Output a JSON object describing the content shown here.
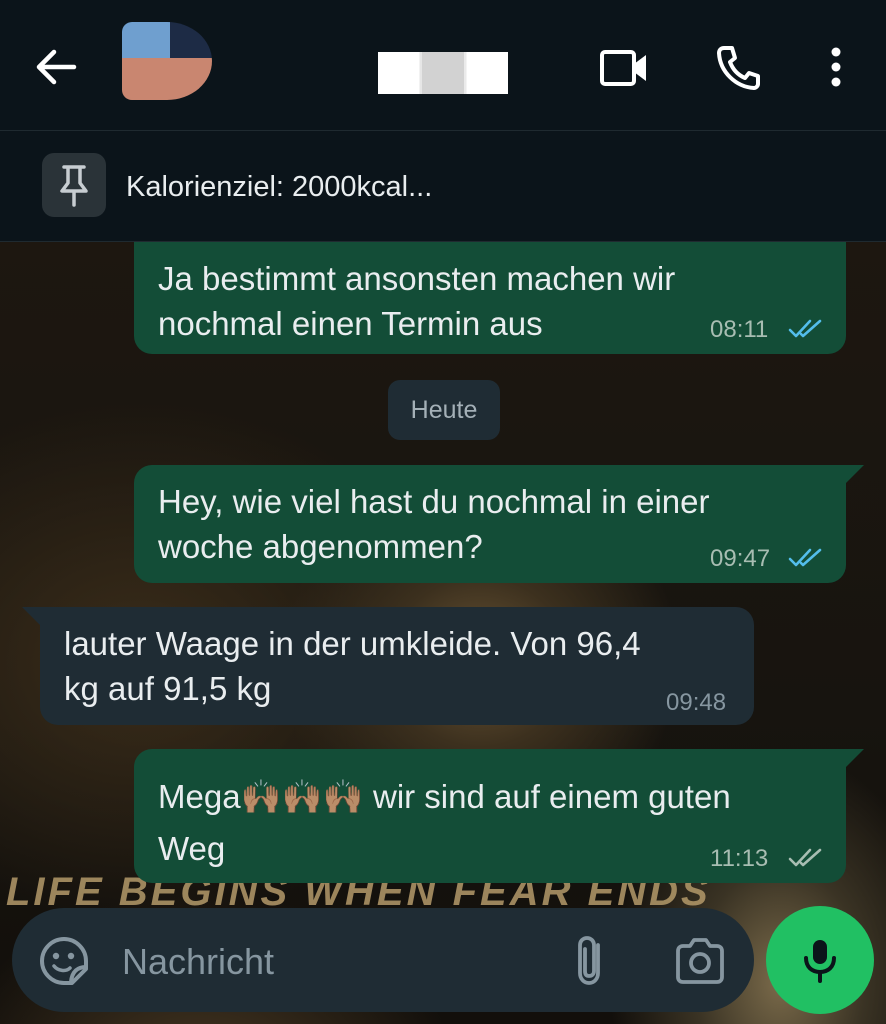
{
  "header": {
    "back_icon": "arrow-left-icon",
    "contact_name": "",
    "video_icon": "video-camera-icon",
    "call_icon": "phone-icon",
    "menu_icon": "more-vertical-icon"
  },
  "pinned": {
    "icon": "pin-icon",
    "text": "Kalorienziel: 2000kcal..."
  },
  "messages": [
    {
      "direction": "out",
      "lines": [
        "Ja bestimmt ansonsten machen wir",
        "nochmal einen Termin aus"
      ],
      "time": "08:11",
      "status": "read"
    },
    {
      "direction": "out",
      "lines": [
        "Hey, wie viel hast du nochmal in einer",
        "woche abgenommen?"
      ],
      "time": "09:47",
      "status": "read"
    },
    {
      "direction": "in",
      "lines": [
        "lauter Waage in der umkleide. Von 96,4",
        "kg auf 91,5 kg"
      ],
      "time": "09:48"
    },
    {
      "direction": "out",
      "lines": [
        "Mega🙌🏽🙌🏽🙌🏽 wir sind auf einem guten",
        "Weg"
      ],
      "time": "11:13",
      "status": "delivered"
    }
  ],
  "day_separator": "Heute",
  "wallpaper_caption": "LIFE BEGINS WHEN FEAR ENDS",
  "composer": {
    "placeholder": "Nachricht",
    "emoji_icon": "sticker-emoji-icon",
    "attach_icon": "paperclip-icon",
    "camera_icon": "camera-icon",
    "mic_icon": "microphone-icon"
  },
  "colors": {
    "outgoing_bubble": "#134d37",
    "incoming_bubble": "#1f2c34",
    "read_ticks": "#53bdeb",
    "accent_green": "#21c063"
  }
}
